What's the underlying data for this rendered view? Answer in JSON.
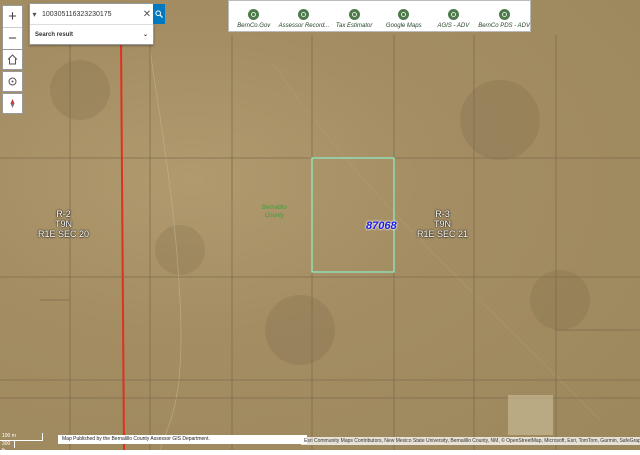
{
  "search": {
    "value": "100305116323230175",
    "result_label": "Search result"
  },
  "zoom": {
    "in": "+",
    "out": "−"
  },
  "links": [
    {
      "label": "BernCo.Gov"
    },
    {
      "label": "Assessor Record..."
    },
    {
      "label": "Tax Estimator"
    },
    {
      "label": "Google Maps"
    },
    {
      "label": "AGIS - ADV"
    },
    {
      "label": "BernCo PDS - ADV"
    }
  ],
  "map": {
    "sections": [
      {
        "line1": "R-2",
        "line2": "T9N",
        "line3": "R1E SEC 20"
      },
      {
        "line1": "R-3",
        "line2": "T9N",
        "line3": "R1E SEC 21"
      }
    ],
    "county": {
      "line1": "Bernalillo",
      "line2": "County"
    },
    "parcel_id": "87068"
  },
  "scale": {
    "top": "100 m",
    "bottom": "300 ft"
  },
  "footer": {
    "published": "Map Published by the Bernalillo County Assessor GIS Department.",
    "attribution": "Esri Community Maps Contributors, New Mexico State University, Bernalillo County, NM, © OpenStreetMap, Microsoft, Esri, TomTom, Garmin, SafeGraph, Ge"
  },
  "colors": {
    "accent": "#0079c1",
    "parcel_outline": "#8ef0c8",
    "section_line": "#e03020"
  }
}
